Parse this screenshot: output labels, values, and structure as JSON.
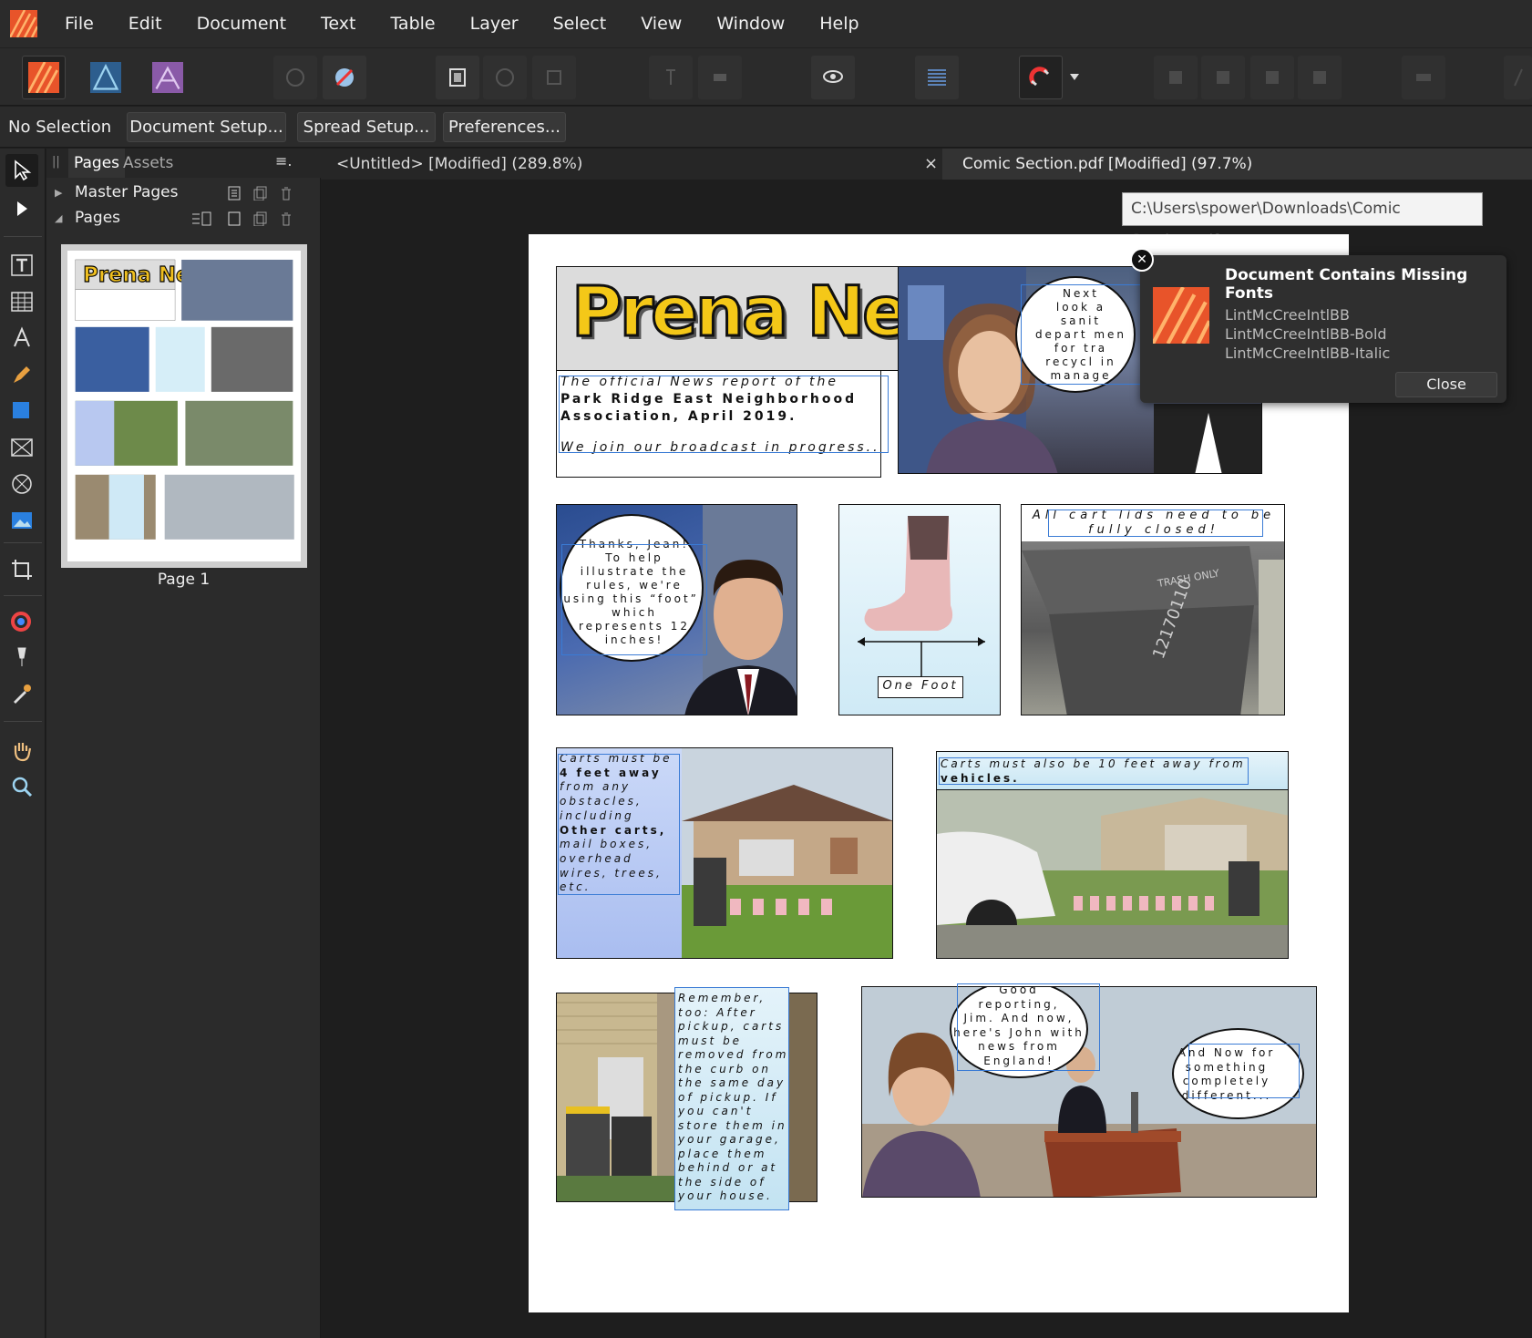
{
  "menu": [
    "File",
    "Edit",
    "Document",
    "Text",
    "Table",
    "Layer",
    "Select",
    "View",
    "Window",
    "Help"
  ],
  "context": {
    "no_selection": "No Selection",
    "document_setup": "Document Setup...",
    "spread_setup": "Spread Setup...",
    "preferences": "Preferences..."
  },
  "panel": {
    "tab_pages": "Pages",
    "tab_assets": "Assets",
    "master_pages": "Master Pages",
    "pages": "Pages",
    "page_label": "Page 1"
  },
  "doc_tabs": {
    "untitled": "<Untitled> [Modified] (289.8%)",
    "close": "×",
    "comic": "Comic Section.pdf [Modified] (97.7%)"
  },
  "path_tooltip": "C:\\Users\\spower\\Downloads\\Comic Section.pdf",
  "comic": {
    "masthead": "Prena News",
    "intro_line1": "The official News report of the",
    "intro_line2": "Park Ridge East Neighborhood",
    "intro_line3": "Association, April 2019.",
    "intro_line4": "We join our broadcast in progress...",
    "bubble_top": [
      "Next",
      "look a",
      "sanit",
      "depart men",
      "for tra",
      "recycl in",
      "manage"
    ],
    "bubble_man": [
      "Thanks, Jean!",
      "To help",
      "illustrate the",
      "rules, we're",
      "using this “foot”,",
      "which",
      "represents 12",
      "inches!"
    ],
    "one_foot": "One Foot",
    "lids_line1": "All cart lids need to be",
    "lids_line2": "fully closed!",
    "carts4_lines": [
      "Carts must be",
      "4 feet away",
      "from any",
      "obstacles,",
      "including",
      "Other carts,",
      "mail boxes,",
      "overhead",
      "wires, trees,",
      "etc."
    ],
    "carts10_line1": "Carts must also be 10 feet away from",
    "carts10_line2": "vehicles.",
    "remember_lines": [
      "Remember,",
      "too: After",
      "pickup, carts",
      "must be",
      "removed from",
      "the curb on",
      "the same day",
      "of pickup. If",
      "you can't",
      "store them in",
      "your garage,",
      "place them",
      "behind or at",
      "the side of",
      "your house."
    ],
    "bubble_jim": [
      "Good",
      "reporting,",
      "Jim. And now,",
      "here's John with",
      "news from",
      "England!"
    ],
    "bubble_now": [
      "And Now for",
      "something",
      "completely",
      "different..."
    ]
  },
  "missing_fonts": {
    "title": "Document Contains Missing Fonts",
    "fonts": [
      "LintMcCreeIntlBB",
      "LintMcCreeIntlBB-Bold",
      "LintMcCreeIntlBB-Italic"
    ],
    "close": "Close",
    "dismiss": "✕"
  },
  "colors": {
    "accent_blue": "#3a7bd5",
    "publisher_orange": "#e8542a",
    "designer_blue": "#2d5e8e",
    "photo_purple": "#8a5aa8"
  }
}
